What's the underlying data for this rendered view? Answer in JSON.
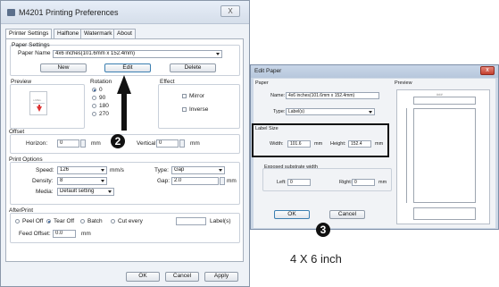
{
  "main_window": {
    "title": "M4201 Printing Preferences",
    "close_label": "X",
    "tabs": [
      "Printer Settings",
      "Halftone",
      "Watermark",
      "About"
    ],
    "paper_settings": {
      "group_label": "Paper Settings",
      "paper_name_label": "Paper Name",
      "paper_name_value": "4x6 inches(101.6mm x 152.4mm)",
      "new_label": "New",
      "edit_label": "Edit",
      "delete_label": "Delete"
    },
    "preview_label": "Preview",
    "preview_text": "LABEL",
    "rotation": {
      "label": "Rotation",
      "options": [
        "0",
        "90",
        "180",
        "270"
      ],
      "selected": "0"
    },
    "effect": {
      "label": "Effect",
      "options": [
        "Mirror",
        "Inverse"
      ]
    },
    "offset": {
      "label": "Offset",
      "horizon_label": "Horizon:",
      "horizon_value": "0",
      "horizon_unit": "mm",
      "vertical_label": "Vertical:",
      "vertical_value": "0",
      "vertical_unit": "mm"
    },
    "print_options": {
      "label": "Print Options",
      "speed_label": "Speed:",
      "speed_value": "126",
      "speed_unit": "mm/s",
      "type_label": "Type:",
      "type_value": "Gap",
      "density_label": "Density:",
      "density_value": "8",
      "gap_label": "Gap:",
      "gap_value": "2.0",
      "gap_unit": "mm",
      "media_label": "Media:",
      "media_value": "Default setting"
    },
    "after_print": {
      "label": "AfterPrint",
      "options": [
        "Peel Off",
        "Tear Off",
        "Batch",
        "Cut every"
      ],
      "selected": "Tear Off",
      "labels_suffix": "Label(s)",
      "feed_offset_label": "Feed Offset:",
      "feed_offset_value": "0.0",
      "feed_offset_unit": "mm"
    },
    "buttons": {
      "ok": "OK",
      "cancel": "Cancel",
      "apply": "Apply"
    }
  },
  "edit_paper": {
    "title": "Edit Paper",
    "close_label": "x",
    "paper_label": "Paper",
    "name_label": "Name:",
    "name_value": "4x6 inches(101.6mm x 152.4mm)",
    "type_label": "Type:",
    "type_value": "Label(s)",
    "label_size": {
      "label": "Label Size",
      "width_label": "Width:",
      "width_value": "101.6",
      "width_unit": "mm",
      "height_label": "Height:",
      "height_value": "152.4",
      "height_unit": "mm"
    },
    "exposed": {
      "label": "Exposed substrate width",
      "left_label": "Left:",
      "left_value": "0",
      "right_label": "Right:",
      "right_value": "0",
      "unit": "mm"
    },
    "preview_label": "Preview",
    "preview_dim_top": "###",
    "ok": "OK",
    "cancel": "Cancel"
  },
  "annotations": {
    "step2": "2",
    "step3": "3",
    "caption": "4 X 6 inch"
  },
  "colors": {
    "annotation": "#111111",
    "close_red": "#c33e2e",
    "preview_arrow": "#dd3333"
  }
}
